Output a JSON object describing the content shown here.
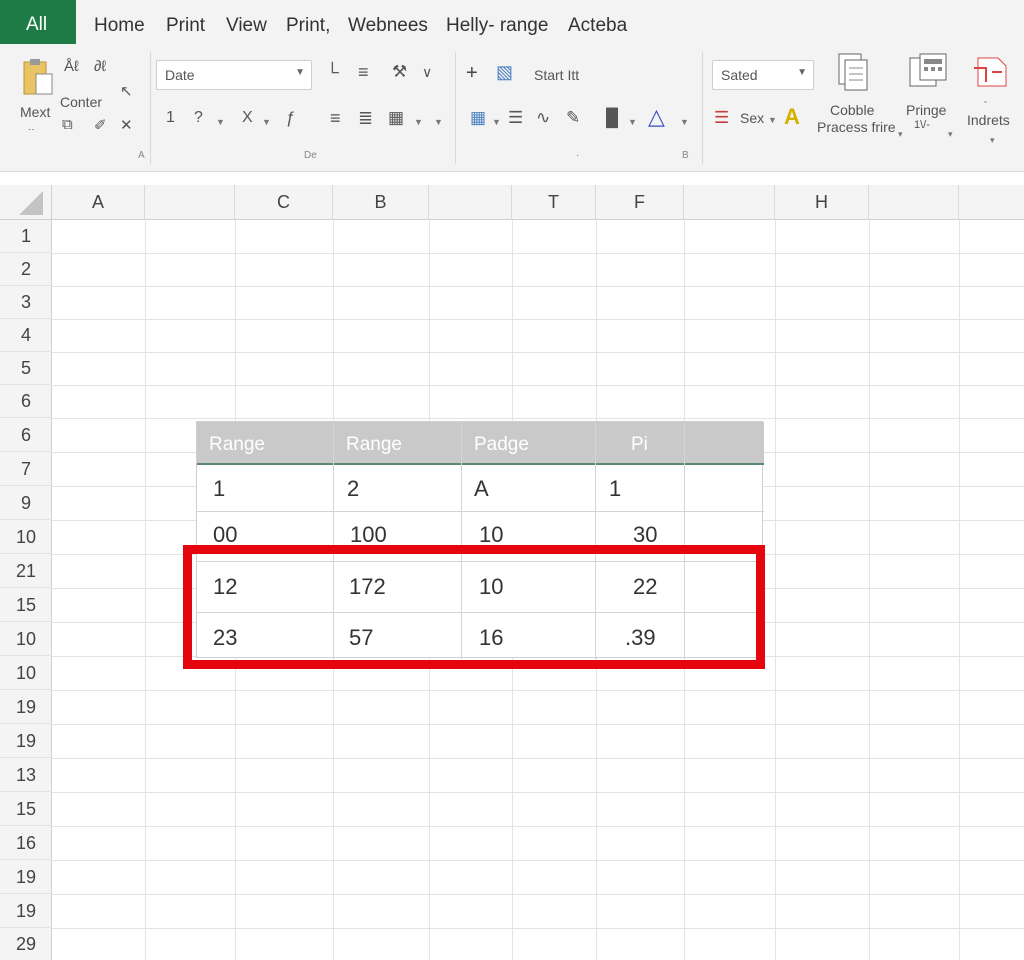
{
  "tabs": {
    "active": "All",
    "items": [
      "Home",
      "Print",
      "View",
      "Print,",
      "Webnees",
      "Helly- range",
      "Acteba"
    ]
  },
  "ribbon": {
    "mext_label": "Mext",
    "conter_label": "Conter",
    "font_dropdown": "Date",
    "start_label": "Start Itt",
    "style_dropdown": "Sated",
    "row2_num1": "1",
    "row2_num2": "?",
    "row2_x": "X",
    "sex_label": "Sex",
    "cobble_label1": "Cobble",
    "cobble_label2": "Pracess frire",
    "pringe_label1": "Pringe",
    "pringe_label2": "1\\/-",
    "indrets_label": "Indrets",
    "group_label_1": "A",
    "group_label_2": "De",
    "group_label_3": "B"
  },
  "columns": [
    "A",
    "C",
    "B",
    "T",
    "F",
    "H"
  ],
  "rows": [
    "1",
    "2",
    "3",
    "4",
    "5",
    "6",
    "6",
    "7",
    "9",
    "10",
    "21",
    "15",
    "10",
    "10",
    "19",
    "19",
    "13",
    "15",
    "16",
    "19",
    "19",
    "29"
  ],
  "table": {
    "headers": [
      "Range",
      "Range",
      "Padge",
      "Pi"
    ],
    "rows": [
      [
        "1",
        "2",
        "A",
        "1"
      ],
      [
        "00",
        "100",
        "10",
        "30"
      ],
      [
        "12",
        "172",
        "10",
        "22"
      ],
      [
        "23",
        "57",
        "16",
        ".39"
      ]
    ]
  },
  "colors": {
    "active_tab": "#1e7b45",
    "highlight": "#e4060c",
    "table_header": "#c9c9c9"
  }
}
